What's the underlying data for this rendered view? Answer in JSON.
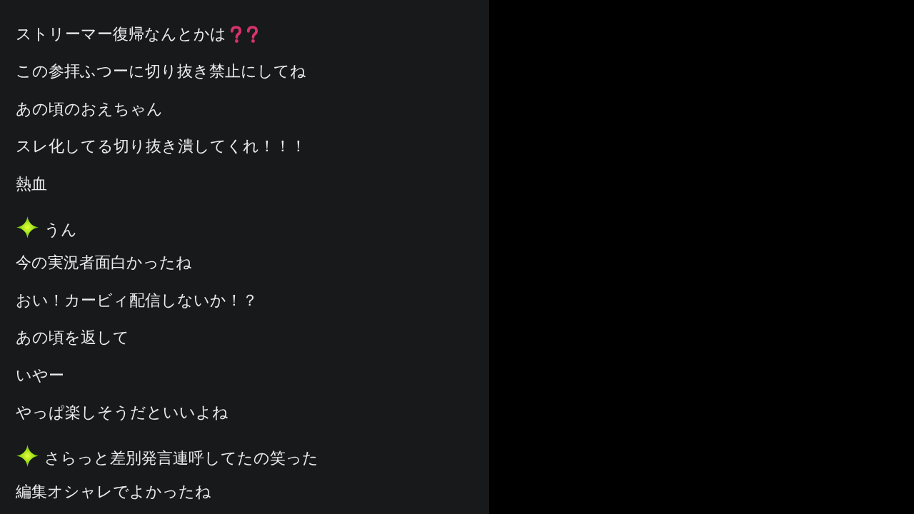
{
  "chat": {
    "messages": [
      {
        "text": "ストリーマー復帰なんとかは",
        "badge": false,
        "emotes": [
          {
            "kind": "question"
          },
          {
            "kind": "question"
          }
        ]
      },
      {
        "text": "この参拝ふつーに切り抜き禁止にしてね",
        "badge": false
      },
      {
        "text": "あの頃のおえちゃん",
        "badge": false
      },
      {
        "text": "スレ化してる切り抜き潰してくれ！！！",
        "badge": false
      },
      {
        "text": "熱血",
        "badge": false
      },
      {
        "text": "うん",
        "badge": true
      },
      {
        "text": "今の実況者面白かったね",
        "badge": false
      },
      {
        "text": "おい！カービィ配信しないか！？",
        "badge": false
      },
      {
        "text": "あの頃を返して",
        "badge": false
      },
      {
        "text": "いやー",
        "badge": false
      },
      {
        "text": "やっぱ楽しそうだといいよね",
        "badge": false
      },
      {
        "text": "さらっと差別発言連呼してたの笑った",
        "badge": true
      },
      {
        "text": "編集オシャレでよかったね",
        "badge": false
      }
    ]
  }
}
